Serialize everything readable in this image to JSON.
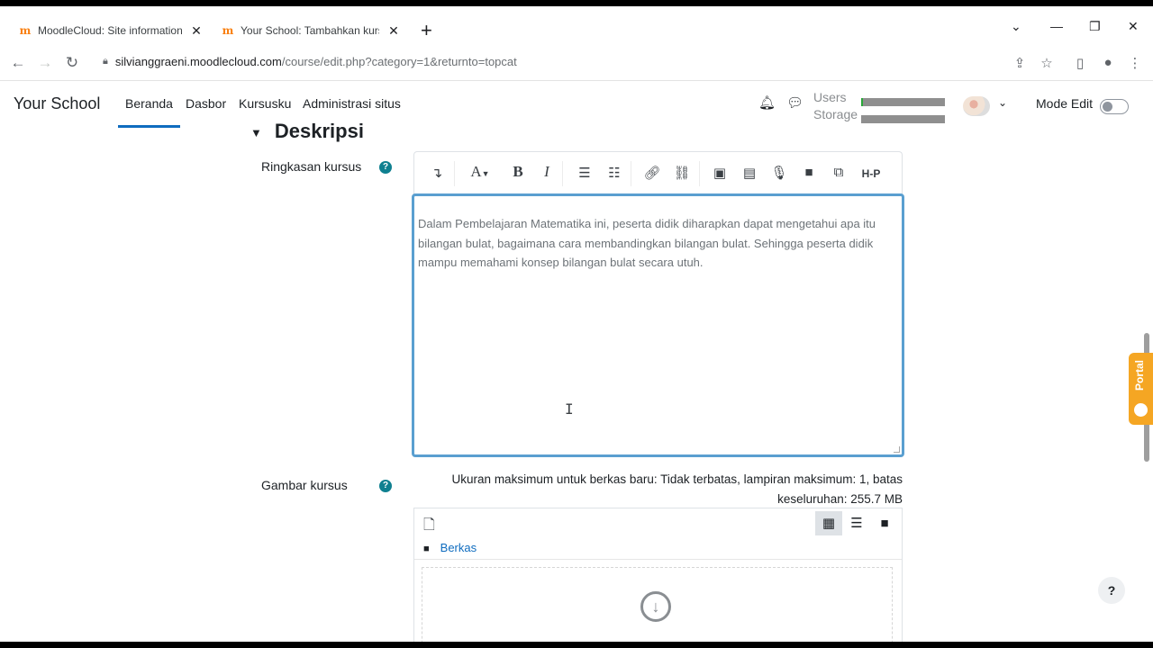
{
  "browser": {
    "tabs": [
      {
        "title": "MoodleCloud: Site information f",
        "active": false
      },
      {
        "title": "Your School: Tambahkan kursus",
        "active": true
      }
    ],
    "url_host": "silvianggraeni.moodlecloud.com",
    "url_path": "/course/edit.php?category=1&returnto=topcat",
    "icons": {
      "back": "back-arrow-icon",
      "forward": "forward-arrow-icon",
      "reload": "reload-icon",
      "lock": "lock-icon",
      "share": "share-icon",
      "star": "star-icon",
      "sidepanel": "side-panel-icon",
      "profile": "profile-icon",
      "menu": "kebab-menu-icon"
    }
  },
  "moodle": {
    "brand": "Your School",
    "nav": [
      "Beranda",
      "Dasbor",
      "Kursusku",
      "Administrasi situs"
    ],
    "active_nav": "Beranda",
    "quota": {
      "users_label": "Users",
      "storage_label": "Storage",
      "users_fraction": 0.02,
      "storage_fraction": 0.0
    },
    "mode_edit_label": "Mode Edit",
    "mode_edit_on": false
  },
  "form": {
    "section_title": "Deskripsi",
    "summary_label": "Ringkasan kursus",
    "summary_text": "Dalam Pembelajaran Matematika ini, peserta didik diharapkan dapat mengetahui apa itu bilangan bulat, bagaimana cara membandingkan bilangan bulat. Sehingga peserta didik mampu memahami konsep bilangan bulat secara utuh.",
    "toolbar_items": [
      "collapse-icon",
      "font-style-icon",
      "bold-icon",
      "italic-icon",
      "unordered-list-icon",
      "ordered-list-icon",
      "link-icon",
      "unlink-icon",
      "image-icon",
      "media-icon",
      "record-audio-icon",
      "record-video-icon",
      "manage-files-icon",
      "h5p-icon"
    ],
    "toolbar_text": {
      "font": "A",
      "bold": "B",
      "italic": "I",
      "h5p": "H-P"
    },
    "image_label": "Gambar kursus",
    "file_note_line1": "Ukuran maksimum untuk berkas baru: Tidak terbatas, lampiran maksimum: 1, batas",
    "file_note_line2": "keseluruhan: 255.7 MB",
    "file_path": "Berkas"
  },
  "side": {
    "portal_label": "Portal",
    "help_label": "?"
  },
  "colors": {
    "accent": "#0f6cbf",
    "editor_focus": "#5a9fd0",
    "help_icon": "#0f8090",
    "portal": "#f5a623"
  }
}
